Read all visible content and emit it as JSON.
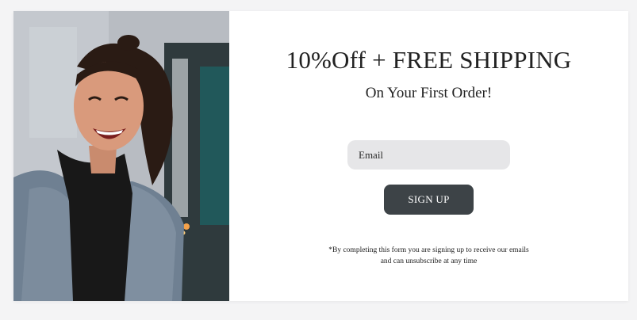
{
  "popup": {
    "headline": "10%Off + FREE SHIPPING",
    "subhead": "On Your First Order!",
    "email_placeholder": "Email",
    "signup_label": "SIGN UP",
    "disclaimer_line1": "*By completing this form you are signing up to receive our emails",
    "disclaimer_line2": "and can unsubscribe at any time"
  },
  "colors": {
    "button_bg": "#3d4347",
    "input_bg": "#e6e6e8",
    "page_bg": "#f4f4f5"
  },
  "icons": {
    "hero": "hero-photo-smiling-woman"
  }
}
